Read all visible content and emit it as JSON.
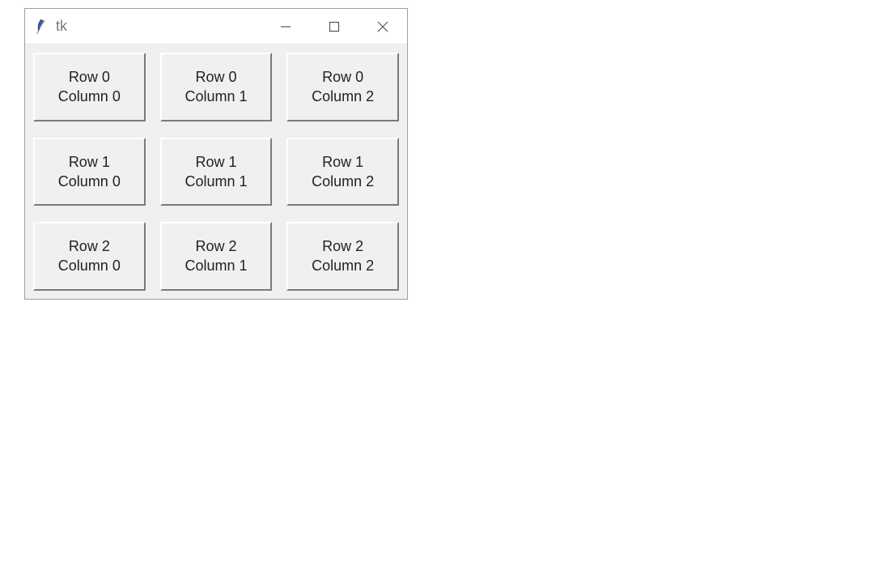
{
  "window": {
    "title": "tk"
  },
  "grid": {
    "rows": [
      [
        {
          "label": "Row 0\nColumn 0"
        },
        {
          "label": "Row 0\nColumn 1"
        },
        {
          "label": "Row 0\nColumn 2"
        }
      ],
      [
        {
          "label": "Row 1\nColumn 0"
        },
        {
          "label": "Row 1\nColumn 1"
        },
        {
          "label": "Row 1\nColumn 2"
        }
      ],
      [
        {
          "label": "Row 2\nColumn 0"
        },
        {
          "label": "Row 2\nColumn 1"
        },
        {
          "label": "Row 2\nColumn 2"
        }
      ]
    ]
  }
}
